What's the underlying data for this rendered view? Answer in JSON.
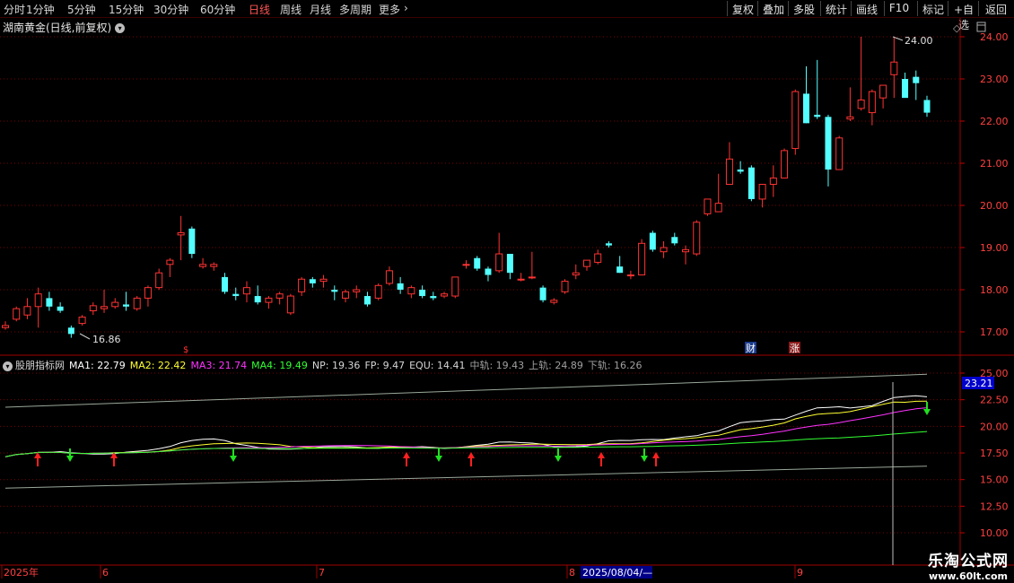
{
  "toolbar": {
    "left": [
      "分时",
      "1分钟",
      "5分钟",
      "15分钟",
      "30分钟",
      "60分钟",
      "日线",
      "周线",
      "月线",
      "多周期",
      "更多"
    ],
    "active": "日线",
    "more_arrow": "›",
    "right": [
      "复权",
      "叠加",
      "多股",
      "统计",
      "画线",
      "F10",
      "+自选",
      "返回"
    ],
    "mark": "标记"
  },
  "stock": {
    "title": "湖南黄金(日线,前复权)"
  },
  "price_axis": {
    "labels": [
      "24.00",
      "23.00",
      "22.00",
      "21.00",
      "20.00",
      "19.00",
      "18.00",
      "17.00"
    ]
  },
  "price_annotations": {
    "high_label": "24.00",
    "low_label": "16.86"
  },
  "markers": {
    "cai": "财",
    "zhang": "涨"
  },
  "indicator": {
    "name": "股朋指标网",
    "ma1": "MA1: 22.79",
    "ma2": "MA2: 22.42",
    "ma3": "MA3: 21.74",
    "ma4": "MA4: 19.49",
    "np": "NP: 19.36",
    "fp": "FP: 9.47",
    "equ": "EQU: 14.41",
    "mid": "中轨: 19.43",
    "upper": "上轨: 24.89",
    "lower": "下轨: 16.26",
    "axis_labels": [
      "25.00",
      "22.50",
      "20.00",
      "17.50",
      "15.00",
      "12.50",
      "10.00"
    ],
    "cursor_value": "23.21",
    "colors": {
      "ma1": "#ffffff",
      "ma2": "#ffff33",
      "ma3": "#ff33ff",
      "ma4": "#33ff33"
    }
  },
  "date_axis": {
    "labels": [
      "2025年",
      "6",
      "7",
      "8",
      "9"
    ],
    "cursor_date": "2025/08/04/—"
  },
  "watermark": {
    "title": "乐淘公式网",
    "url": "www.60lt.com"
  },
  "chart_data": {
    "type": "candlestick",
    "y_range": [
      16.7,
      24.2
    ],
    "candles": [
      [
        17.1,
        17.25,
        17.05,
        17.15
      ],
      [
        17.3,
        17.6,
        17.25,
        17.55
      ],
      [
        17.4,
        17.8,
        17.3,
        17.6
      ],
      [
        17.6,
        18.05,
        17.1,
        17.9
      ],
      [
        17.8,
        17.95,
        17.5,
        17.6
      ],
      [
        17.6,
        17.7,
        17.45,
        17.5
      ],
      [
        17.1,
        17.15,
        16.86,
        16.95
      ],
      [
        17.2,
        17.4,
        17.15,
        17.35
      ],
      [
        17.5,
        17.7,
        17.4,
        17.62
      ],
      [
        17.55,
        18.0,
        17.45,
        17.6
      ],
      [
        17.6,
        17.8,
        17.55,
        17.7
      ],
      [
        17.65,
        17.95,
        17.5,
        17.6
      ],
      [
        17.55,
        17.85,
        17.5,
        17.8
      ],
      [
        17.8,
        18.1,
        17.6,
        18.05
      ],
      [
        18.05,
        18.5,
        18.0,
        18.4
      ],
      [
        18.6,
        18.75,
        18.3,
        18.7
      ],
      [
        19.3,
        19.75,
        18.7,
        19.35
      ],
      [
        19.45,
        19.5,
        18.75,
        18.85
      ],
      [
        18.55,
        18.75,
        18.5,
        18.6
      ],
      [
        18.55,
        18.65,
        18.45,
        18.6
      ],
      [
        18.3,
        18.4,
        17.9,
        17.95
      ],
      [
        17.9,
        18.05,
        17.75,
        17.85
      ],
      [
        17.9,
        18.2,
        17.7,
        18.05
      ],
      [
        17.85,
        18.1,
        17.65,
        17.7
      ],
      [
        17.7,
        17.85,
        17.55,
        17.8
      ],
      [
        17.8,
        17.95,
        17.65,
        17.9
      ],
      [
        17.45,
        17.9,
        17.4,
        17.85
      ],
      [
        17.95,
        18.3,
        17.85,
        18.25
      ],
      [
        18.25,
        18.3,
        18.05,
        18.15
      ],
      [
        18.2,
        18.35,
        18.05,
        18.25
      ],
      [
        18.0,
        18.1,
        17.75,
        17.95
      ],
      [
        17.8,
        18.0,
        17.7,
        17.95
      ],
      [
        17.95,
        18.1,
        17.8,
        18.0
      ],
      [
        17.85,
        17.95,
        17.6,
        17.65
      ],
      [
        17.8,
        18.15,
        17.75,
        18.1
      ],
      [
        18.15,
        18.55,
        18.1,
        18.45
      ],
      [
        18.15,
        18.3,
        17.9,
        18.0
      ],
      [
        17.9,
        18.1,
        17.8,
        18.05
      ],
      [
        18.0,
        18.1,
        17.8,
        17.85
      ],
      [
        17.85,
        17.95,
        17.75,
        17.8
      ],
      [
        17.85,
        17.95,
        17.8,
        17.9
      ],
      [
        17.85,
        18.3,
        17.8,
        18.3
      ],
      [
        18.6,
        18.7,
        18.5,
        18.6
      ],
      [
        18.75,
        18.8,
        18.45,
        18.5
      ],
      [
        18.5,
        18.55,
        18.2,
        18.35
      ],
      [
        18.45,
        19.35,
        18.4,
        18.85
      ],
      [
        18.85,
        18.85,
        18.25,
        18.4
      ],
      [
        18.25,
        18.4,
        18.2,
        18.25
      ],
      [
        18.3,
        18.9,
        18.25,
        18.3
      ],
      [
        18.05,
        18.1,
        17.7,
        17.75
      ],
      [
        17.7,
        17.8,
        17.65,
        17.75
      ],
      [
        17.95,
        18.25,
        17.9,
        18.2
      ],
      [
        18.35,
        18.6,
        18.25,
        18.4
      ],
      [
        18.55,
        18.7,
        18.45,
        18.7
      ],
      [
        18.65,
        18.95,
        18.6,
        18.85
      ],
      [
        19.1,
        19.15,
        19.0,
        19.05
      ],
      [
        18.55,
        18.8,
        18.4,
        18.4
      ],
      [
        18.35,
        18.45,
        18.25,
        18.35
      ],
      [
        18.35,
        19.2,
        18.35,
        19.1
      ],
      [
        19.35,
        19.4,
        18.9,
        18.95
      ],
      [
        18.9,
        19.15,
        18.75,
        19.0
      ],
      [
        19.25,
        19.35,
        19.05,
        19.1
      ],
      [
        18.9,
        19.05,
        18.6,
        18.95
      ],
      [
        18.85,
        19.65,
        18.8,
        19.6
      ],
      [
        19.8,
        20.15,
        19.75,
        20.15
      ],
      [
        19.85,
        20.75,
        19.85,
        20.05
      ],
      [
        20.5,
        21.5,
        20.5,
        21.1
      ],
      [
        20.85,
        21.05,
        20.75,
        20.8
      ],
      [
        20.9,
        20.95,
        20.1,
        20.15
      ],
      [
        20.15,
        20.5,
        19.95,
        20.5
      ],
      [
        20.5,
        20.95,
        20.2,
        20.65
      ],
      [
        20.65,
        21.35,
        20.65,
        21.3
      ],
      [
        21.35,
        22.75,
        21.2,
        22.7
      ],
      [
        22.65,
        23.3,
        21.95,
        21.95
      ],
      [
        22.15,
        23.45,
        22.05,
        22.1
      ],
      [
        22.1,
        22.15,
        20.45,
        20.85
      ],
      [
        20.85,
        21.65,
        20.85,
        21.6
      ],
      [
        22.05,
        22.8,
        22.0,
        22.1
      ],
      [
        22.3,
        24.0,
        22.25,
        22.5
      ],
      [
        22.2,
        22.75,
        21.9,
        22.7
      ],
      [
        22.55,
        22.85,
        22.3,
        22.85
      ],
      [
        23.1,
        24.0,
        22.55,
        23.4
      ],
      [
        23.0,
        23.15,
        22.6,
        22.55
      ],
      [
        23.05,
        23.2,
        22.5,
        22.9
      ],
      [
        22.5,
        22.6,
        22.1,
        22.2
      ]
    ]
  }
}
